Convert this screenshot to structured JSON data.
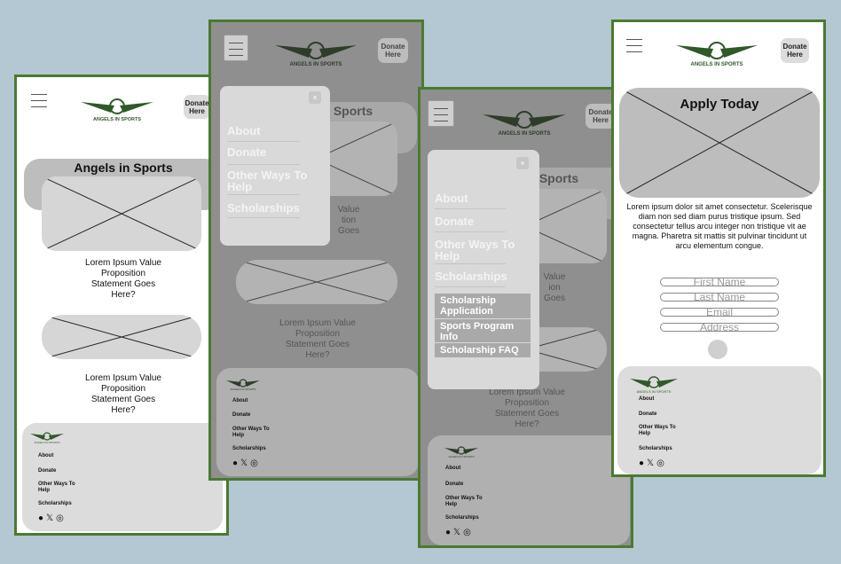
{
  "brand": {
    "logo_text": "ANGELS IN SPORTS",
    "accent": "#2f5a28",
    "frame_border": "#4a7a30"
  },
  "header": {
    "donate_label_line1": "Donate",
    "donate_label_line2": "Here"
  },
  "home": {
    "title": "Angels in Sports",
    "value_prop_1": [
      "Lorem Ipsum Value",
      "Proposition",
      "Statement Goes",
      "Here?"
    ],
    "value_prop_2": [
      "Lorem Ipsum Value",
      "Proposition",
      "Statement Goes",
      "Here?"
    ]
  },
  "menu": {
    "close": "×",
    "items": [
      "About",
      "Donate",
      "Other Ways To Help",
      "Scholarships"
    ],
    "submenu": [
      "Scholarship Application",
      "Sports Program Info",
      "Scholarship FAQ"
    ]
  },
  "bg_text": {
    "title_fragment": "Sports",
    "vp_fragment": [
      "Value",
      "tion",
      "Goes"
    ],
    "vp_fragment2": [
      "Value",
      "ion",
      "Goes"
    ]
  },
  "footer": {
    "links": [
      "About",
      "Donate",
      "Other Ways To Help",
      "Scholarships"
    ],
    "social_icons": [
      "facebook-icon",
      "x-icon",
      "instagram-icon"
    ]
  },
  "apply": {
    "title": "Apply Today",
    "paragraph": "Lorem ipsum dolor sit amet consectetur. Scelerisque diam non sed diam purus tristique ipsum. Sed consectetur tellus arcu integer non tristique vit ae magna. Pharetra sit mattis sit pulvinar tincidunt ut arcu elementum congue.",
    "fields": [
      {
        "placeholder": "First Name"
      },
      {
        "placeholder": "Last Name"
      },
      {
        "placeholder": "Email"
      },
      {
        "placeholder": "Address"
      }
    ]
  }
}
